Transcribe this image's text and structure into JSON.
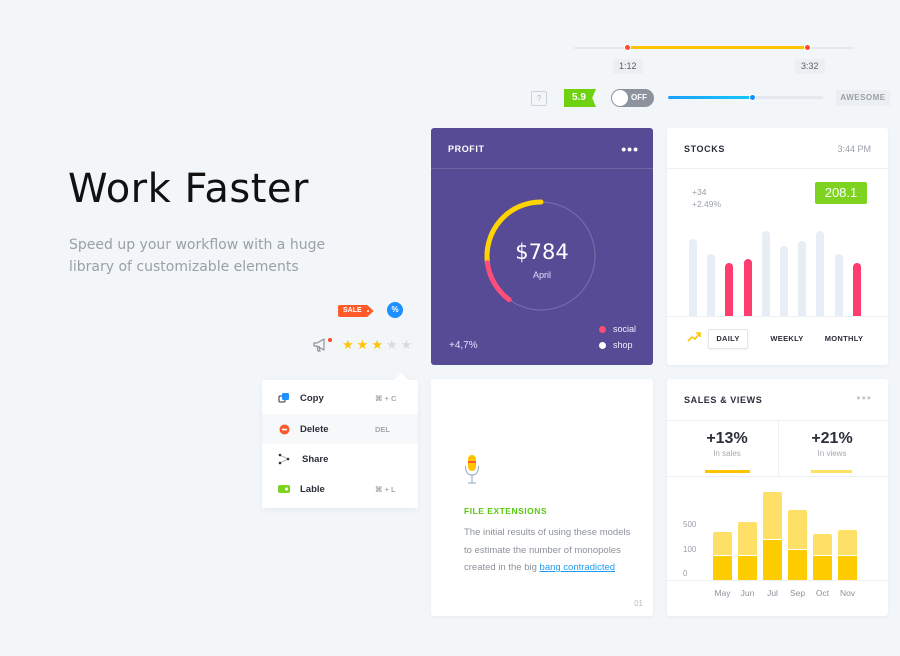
{
  "hero": {
    "title": "Work Faster",
    "subtitle": "Speed up your workflow with a huge library of customizable elements"
  },
  "range_slider": {
    "start_label": "1:12",
    "end_label": "3:32",
    "start_fraction": 0.19,
    "end_fraction": 0.83,
    "accent": "#ffc400"
  },
  "controls": {
    "help_label": "?",
    "score": "5.9",
    "toggle_label": "OFF",
    "toggle_on": false,
    "progress_fraction": 0.54,
    "awesome_label": "AWESOME"
  },
  "profit": {
    "title": "PROFIT",
    "menu_icon": "more-horizontal-icon",
    "amount": "$784",
    "month": "April",
    "change": "+4,7%",
    "legend": [
      {
        "label": "social",
        "color": "#ff4d7a"
      },
      {
        "label": "shop",
        "color": "#ffffff"
      }
    ],
    "ring": {
      "social_fraction": 0.13,
      "shop_fraction": 0.27,
      "shop_color": "#ffd400",
      "social_color": "#ff4d7a"
    },
    "background": "#574b96"
  },
  "stocks": {
    "title": "STOCKS",
    "time": "3:44 PM",
    "change_abs": "+34",
    "change_pct": "+2.49%",
    "value": "208.1",
    "value_color": "#7ed321",
    "bars": [
      {
        "value": 0.81,
        "highlight": false
      },
      {
        "value": 0.65,
        "highlight": false
      },
      {
        "value": 0.56,
        "highlight": true
      },
      {
        "value": 0.6,
        "highlight": true
      },
      {
        "value": 0.9,
        "highlight": false
      },
      {
        "value": 0.74,
        "highlight": false
      },
      {
        "value": 0.79,
        "highlight": false
      },
      {
        "value": 0.9,
        "highlight": false
      },
      {
        "value": 0.65,
        "highlight": false
      },
      {
        "value": 0.56,
        "highlight": true
      }
    ],
    "bar_color": "#e8eef5",
    "highlight_color": "#ff3d6e",
    "periods": [
      "DAILY",
      "WEEKLY",
      "MONTHLY"
    ],
    "active_period": "DAILY"
  },
  "file_card": {
    "title": "FILE EXTENSIONS",
    "body": "The initial results of using these models to estimate the number of monopoles created in the big ",
    "link": "bang contradicted",
    "page": "01"
  },
  "sales_views": {
    "title": "SALES & VIEWS",
    "stats": [
      {
        "value": "+13%",
        "label": "In sales",
        "color": "#ffc400"
      },
      {
        "value": "+21%",
        "label": "In views",
        "color": "#ffe066"
      }
    ]
  },
  "chart_data": {
    "type": "bar",
    "title": "SALES & VIEWS",
    "categories": [
      "May",
      "Jun",
      "Jul",
      "Sep",
      "Oct",
      "Nov"
    ],
    "y_ticks": [
      "0",
      "100",
      "500"
    ],
    "series": [
      {
        "name": "sales",
        "color": "#ffcc00",
        "values": [
          24,
          24,
          40,
          30,
          24,
          24
        ]
      },
      {
        "name": "views",
        "color": "#ffe066",
        "values": [
          24,
          34,
          48,
          40,
          22,
          26
        ]
      }
    ],
    "stacked": true,
    "ylim": [
      0,
      90
    ],
    "grid": false
  },
  "badges": {
    "sale": "SALE",
    "percent": "%",
    "rating": 3,
    "rating_max": 5
  },
  "context_menu": {
    "items": [
      {
        "label": "Copy",
        "shortcut": "⌘ + C",
        "icon": "copy-icon",
        "color": "#1e90ff"
      },
      {
        "label": "Delete",
        "shortcut": "DEL",
        "icon": "delete-icon",
        "color": "#ff5a2a"
      },
      {
        "label": "Share",
        "shortcut": "",
        "icon": "share-icon",
        "color": "#2b2f3a"
      },
      {
        "label": "Lable",
        "shortcut": "⌘ + L",
        "icon": "label-icon",
        "color": "#7ed321"
      }
    ]
  }
}
